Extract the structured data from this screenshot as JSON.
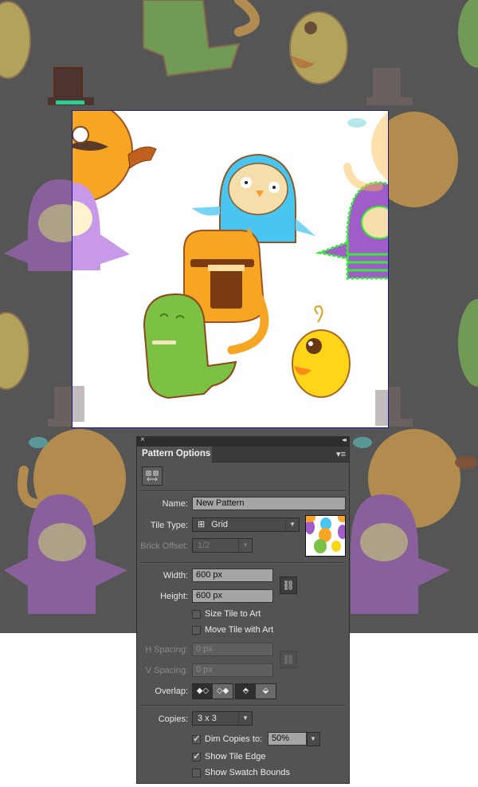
{
  "canvas": {
    "background_color": "#555555",
    "tile_edge_color": "#1a1a8c",
    "characters": [
      {
        "name": "cat-with-top-hat",
        "tile": "center",
        "description": "orange cat with monocle, mustache, tea cup, pipe and top hat"
      },
      {
        "name": "purple-owl",
        "tile": "center",
        "description": "purple owl with wings",
        "selected": true
      },
      {
        "name": "blue-owl",
        "tile": "center",
        "description": "blue owl with wings"
      },
      {
        "name": "coffee-cat",
        "tile": "center",
        "description": "orange cat with glasses holding coffee cup"
      },
      {
        "name": "green-dinosaur",
        "tile": "center",
        "description": "green dinosaur"
      },
      {
        "name": "yellow-bird",
        "tile": "center",
        "description": "yellow bird with orange beak"
      }
    ]
  },
  "panel": {
    "title": "Pattern Options",
    "close_label": "×",
    "collapse_label": "◂◂",
    "menu_label": "▾≡",
    "tile_editor_tooltip": "Pattern Tile Tool",
    "name_label": "Name:",
    "name_value": "New Pattern",
    "tile_type_label": "Tile Type:",
    "tile_type_value": "Grid",
    "brick_offset_label": "Brick Offset:",
    "brick_offset_value": "1/2",
    "width_label": "Width:",
    "width_value": "600 px",
    "height_label": "Height:",
    "height_value": "600 px",
    "size_tile_to_art_label": "Size Tile to Art",
    "size_tile_to_art_checked": false,
    "move_tile_with_art_label": "Move Tile with Art",
    "move_tile_with_art_checked": false,
    "h_spacing_label": "H Spacing:",
    "h_spacing_value": "0 px",
    "v_spacing_label": "V Spacing:",
    "v_spacing_value": "0 px",
    "overlap_label": "Overlap:",
    "copies_label": "Copies:",
    "copies_value": "3 x 3",
    "dim_copies_label": "Dim Copies to:",
    "dim_copies_checked": true,
    "dim_copies_value": "50%",
    "show_tile_edge_label": "Show Tile Edge",
    "show_tile_edge_checked": true,
    "show_swatch_bounds_label": "Show Swatch Bounds",
    "show_swatch_bounds_checked": false,
    "check_glyph": "✓"
  }
}
